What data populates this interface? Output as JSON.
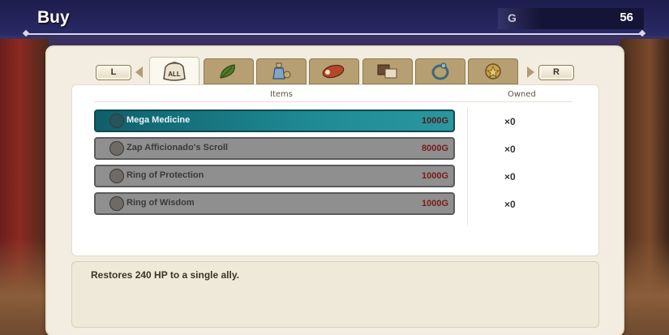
{
  "header": {
    "title": "Buy",
    "currency_label": "G",
    "gold_amount": "56"
  },
  "tabs": {
    "left_shoulder": "L",
    "right_shoulder": "R",
    "items": [
      {
        "id": "all",
        "label": "ALL",
        "icon": "bag-icon",
        "active": true
      },
      {
        "id": "herbs",
        "icon": "leaf-icon"
      },
      {
        "id": "potions",
        "icon": "potion-icon"
      },
      {
        "id": "food",
        "icon": "meat-icon"
      },
      {
        "id": "documents",
        "icon": "scroll-chest-icon"
      },
      {
        "id": "rings",
        "icon": "ring-icon"
      },
      {
        "id": "medals",
        "icon": "medal-icon"
      }
    ]
  },
  "list": {
    "col_items": "Items",
    "col_owned": "Owned",
    "rows": [
      {
        "name": "Mega Medicine",
        "price": "1000G",
        "owned": "×0",
        "selected": true
      },
      {
        "name": "Zap Afficionado's Scroll",
        "price": "8000G",
        "owned": "×0"
      },
      {
        "name": "Ring of Protection",
        "price": "1000G",
        "owned": "×0"
      },
      {
        "name": "Ring of Wisdom",
        "price": "1000G",
        "owned": "×0"
      }
    ]
  },
  "description": "Restores 240 HP to a single ally.",
  "colors": {
    "selected_row": "#1f8a94",
    "row": "#8f8f8f",
    "price_text": "#7a1a1a",
    "panel": "#f2ede0"
  }
}
